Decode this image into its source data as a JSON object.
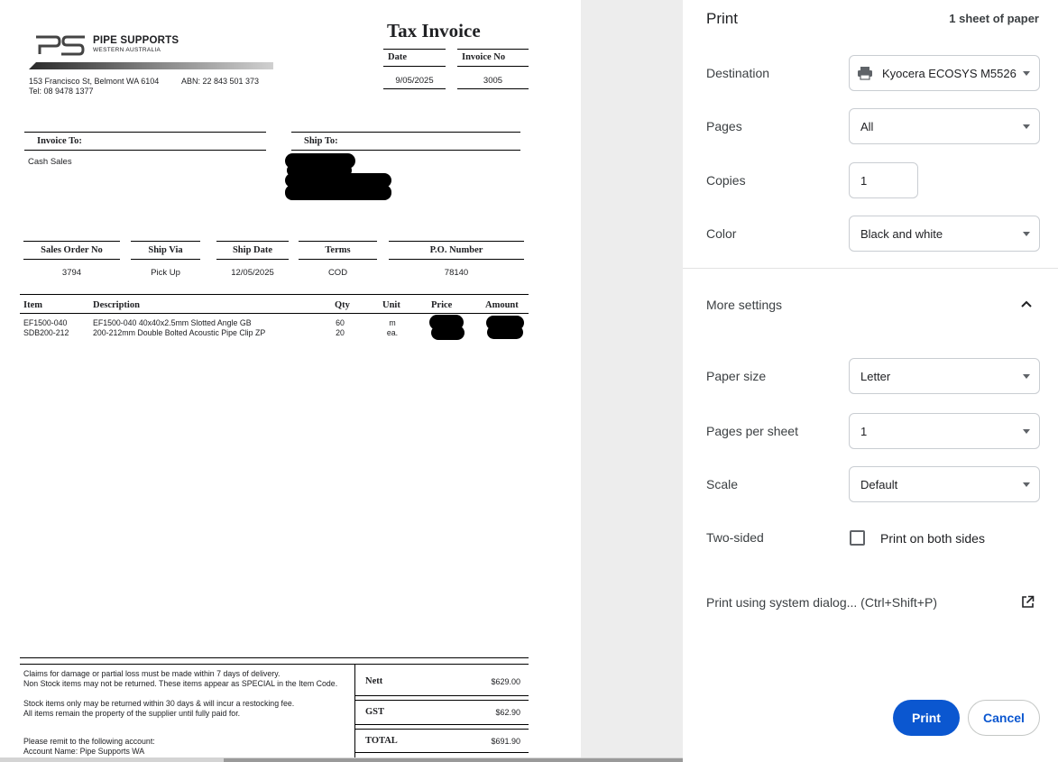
{
  "invoice": {
    "company_name": "PIPE SUPPORTS",
    "company_sub": "WESTERN AUSTRALIA",
    "address": "153 Francisco St, Belmont WA 6104",
    "abn": "ABN: 22 843 501 373",
    "tel": "Tel: 08 9478 1377",
    "title": "Tax Invoice",
    "date_label": "Date",
    "date_value": "9/05/2025",
    "invoice_no_label": "Invoice No",
    "invoice_no_value": "3005",
    "invoice_to_label": "Invoice To:",
    "invoice_to_value": "Cash Sales",
    "ship_to_label": "Ship To:",
    "order_headers": [
      "Sales Order No",
      "Ship Via",
      "Ship Date",
      "Terms",
      "P.O. Number"
    ],
    "order_values": [
      "3794",
      "Pick Up",
      "12/05/2025",
      "COD",
      "78140"
    ],
    "item_headers": [
      "Item",
      "Description",
      "Qty",
      "Unit",
      "Price",
      "Amount"
    ],
    "items": [
      {
        "item": "EF1500-040",
        "description": "EF1500-040 40x40x2.5mm Slotted Angle GB",
        "qty": "60",
        "unit": "m"
      },
      {
        "item": "SDB200-212",
        "description": "200-212mm Double Bolted Acoustic Pipe Clip ZP",
        "qty": "20",
        "unit": "ea."
      }
    ],
    "terms_lines": [
      "Claims for damage or partial loss must be made within 7 days of delivery.",
      "Non Stock items may not be returned. These items appear as SPECIAL in the Item Code.",
      "Stock items only may be returned within 30 days & will incur a restocking fee.",
      "All items remain the property of the supplier until fully paid for."
    ],
    "remit_line": "Please remit to the following account:",
    "account_line": "Account Name:  Pipe Supports WA",
    "nett_label": "Nett",
    "nett_value": "$629.00",
    "gst_label": "GST",
    "gst_value": "$62.90",
    "total_label": "TOTAL",
    "total_value": "$691.90"
  },
  "print": {
    "title": "Print",
    "sheet_count": "1 sheet of paper",
    "destination_label": "Destination",
    "destination_value": "Kyocera ECOSYS M5526",
    "pages_label": "Pages",
    "pages_value": "All",
    "copies_label": "Copies",
    "copies_value": "1",
    "color_label": "Color",
    "color_value": "Black and white",
    "more_settings_label": "More settings",
    "paper_size_label": "Paper size",
    "paper_size_value": "Letter",
    "pages_per_sheet_label": "Pages per sheet",
    "pages_per_sheet_value": "1",
    "scale_label": "Scale",
    "scale_value": "Default",
    "two_sided_label": "Two-sided",
    "two_sided_option": "Print on both sides",
    "system_dialog_label": "Print using system dialog... (Ctrl+Shift+P)",
    "print_button": "Print",
    "cancel_button": "Cancel",
    "accent_color": "#0b57d0",
    "icons": [
      "printer-icon",
      "chevron-up-icon",
      "open-in-new-icon"
    ]
  }
}
